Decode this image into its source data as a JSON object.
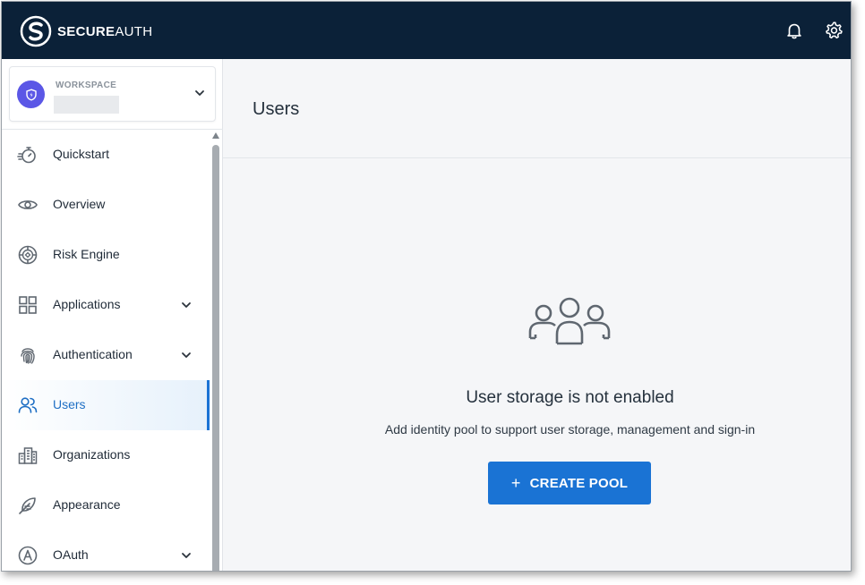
{
  "brand": {
    "name_bold": "SECURE",
    "name_regular": "AUTH"
  },
  "topbar": {
    "icons": [
      "bell-icon",
      "gear-icon"
    ]
  },
  "workspace": {
    "label": "WORKSPACE",
    "name": ""
  },
  "nav": {
    "items": [
      {
        "label": "Quickstart",
        "icon": "stopwatch-icon",
        "expandable": false,
        "active": false
      },
      {
        "label": "Overview",
        "icon": "eye-icon",
        "expandable": false,
        "active": false
      },
      {
        "label": "Risk Engine",
        "icon": "risk-engine-icon",
        "expandable": false,
        "active": false
      },
      {
        "label": "Applications",
        "icon": "grid-icon",
        "expandable": true,
        "active": false
      },
      {
        "label": "Authentication",
        "icon": "fingerprint-icon",
        "expandable": true,
        "active": false
      },
      {
        "label": "Users",
        "icon": "users-icon",
        "expandable": false,
        "active": true
      },
      {
        "label": "Organizations",
        "icon": "building-icon",
        "expandable": false,
        "active": false
      },
      {
        "label": "Appearance",
        "icon": "feather-icon",
        "expandable": false,
        "active": false
      },
      {
        "label": "OAuth",
        "icon": "oauth-icon",
        "expandable": true,
        "active": false
      }
    ]
  },
  "main": {
    "title": "Users",
    "empty_state": {
      "title": "User storage is not enabled",
      "description": "Add identity pool to support user storage, management and sign-in",
      "button_label": "CREATE POOL",
      "button_icon": "+"
    }
  },
  "colors": {
    "topbar": "#0b2138",
    "accent": "#1a73d4",
    "workspace_avatar": "#5b57e6"
  }
}
